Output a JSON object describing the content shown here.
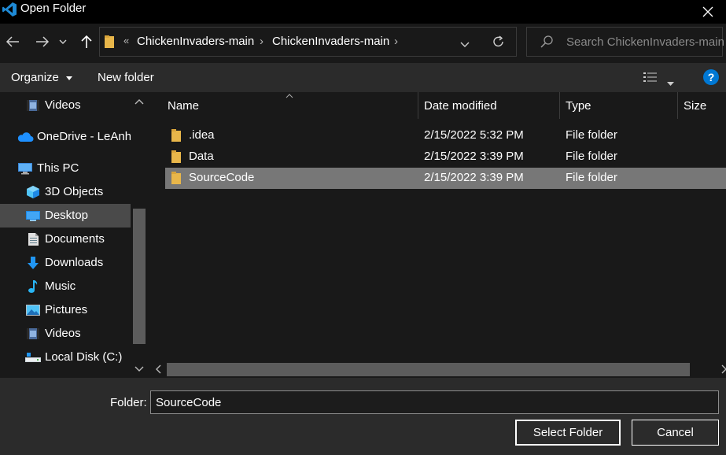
{
  "window": {
    "title": "Open Folder"
  },
  "nav": {
    "back_icon": "arrow-left-icon",
    "forward_icon": "arrow-right-icon",
    "recent_icon": "chevron-down-icon",
    "up_icon": "arrow-up-icon"
  },
  "address": {
    "overflow": "«",
    "crumbs": [
      "ChickenInvaders-main",
      "ChickenInvaders-main"
    ],
    "separator": "›"
  },
  "search": {
    "placeholder": "Search ChickenInvaders-main"
  },
  "toolbar": {
    "organize": "Organize",
    "new_folder": "New folder",
    "help": "?"
  },
  "sidebar": {
    "items": [
      {
        "label": "Videos",
        "icon": "videos-icon"
      },
      {
        "label": "OneDrive - LeAnh:",
        "icon": "onedrive-icon"
      },
      {
        "label": "This PC",
        "icon": "computer-icon"
      },
      {
        "label": "3D Objects",
        "icon": "3d-objects-icon"
      },
      {
        "label": "Desktop",
        "icon": "desktop-icon",
        "selected": true
      },
      {
        "label": "Documents",
        "icon": "documents-icon"
      },
      {
        "label": "Downloads",
        "icon": "downloads-icon"
      },
      {
        "label": "Music",
        "icon": "music-icon"
      },
      {
        "label": "Pictures",
        "icon": "pictures-icon"
      },
      {
        "label": "Videos",
        "icon": "videos-icon"
      },
      {
        "label": "Local Disk (C:)",
        "icon": "drive-icon"
      }
    ]
  },
  "filelist": {
    "columns": [
      "Name",
      "Date modified",
      "Type",
      "Size"
    ],
    "rows": [
      {
        "name": ".idea",
        "date": "2/15/2022 5:32 PM",
        "type": "File folder"
      },
      {
        "name": "Data",
        "date": "2/15/2022 3:39 PM",
        "type": "File folder"
      },
      {
        "name": "SourceCode",
        "date": "2/15/2022 3:39 PM",
        "type": "File folder",
        "selected": true
      }
    ]
  },
  "footer": {
    "folder_label": "Folder:",
    "folder_value": "SourceCode",
    "select_button": "Select Folder",
    "cancel_button": "Cancel"
  },
  "colors": {
    "accent": "#0078d4",
    "folder": "#e8b64a",
    "selected_row": "#777777",
    "selected_nav": "#4a4a4a"
  }
}
